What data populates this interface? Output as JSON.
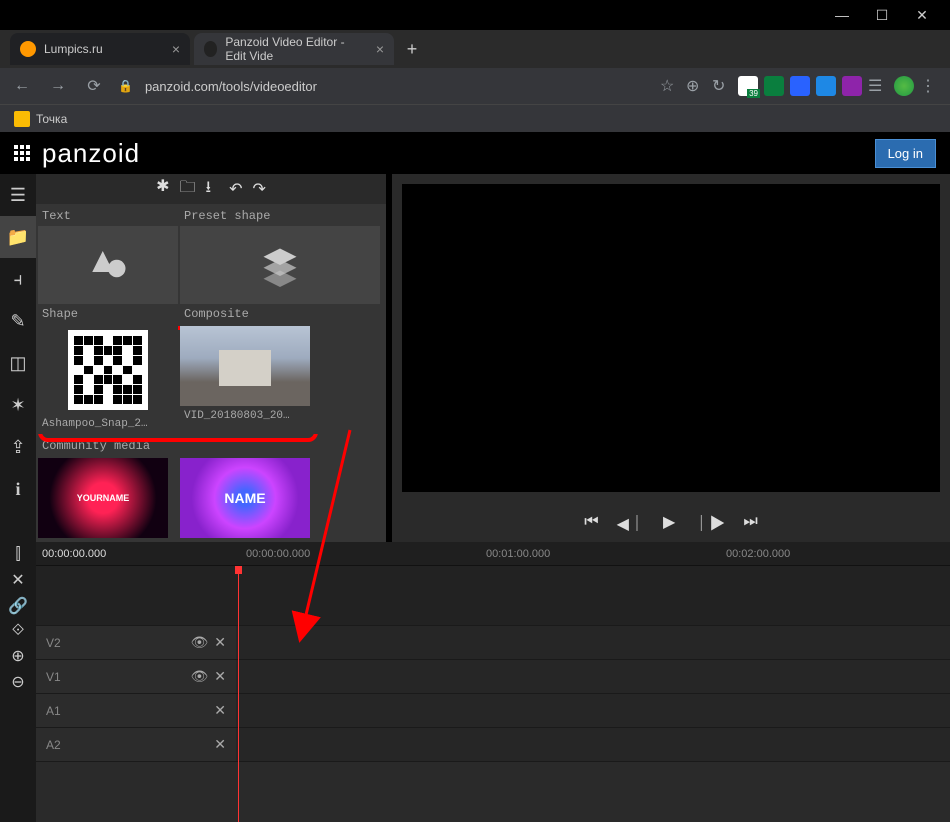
{
  "window": {
    "tabs": [
      {
        "title": "Lumpics.ru",
        "favicon_color": "#ff9800"
      },
      {
        "title": "Panzoid Video Editor - Edit Vide",
        "favicon_color": "#111"
      }
    ]
  },
  "address_bar": {
    "url": "panzoid.com/tools/videoeditor"
  },
  "bookmarks": {
    "item1": "Точка"
  },
  "app": {
    "logo": "panzoid",
    "login": "Log in"
  },
  "media": {
    "text_label": "Text",
    "preset_label": "Preset shape",
    "shape_label": "Shape",
    "composite_label": "Composite",
    "file1": "Ashampoo_Snap_2…",
    "file2": "VID_20180803_20…",
    "community_label": "Community media",
    "cm1_text": "YOURNAME",
    "cm2_text": "NAME"
  },
  "timeline": {
    "current": "00:00:00.000",
    "mark1": "00:00:00.000",
    "mark2": "00:01:00.000",
    "mark3": "00:02:00.000",
    "tracks": {
      "v2": "V2",
      "v1": "V1",
      "a1": "A1",
      "a2": "A2"
    }
  },
  "ext_badge": "39"
}
